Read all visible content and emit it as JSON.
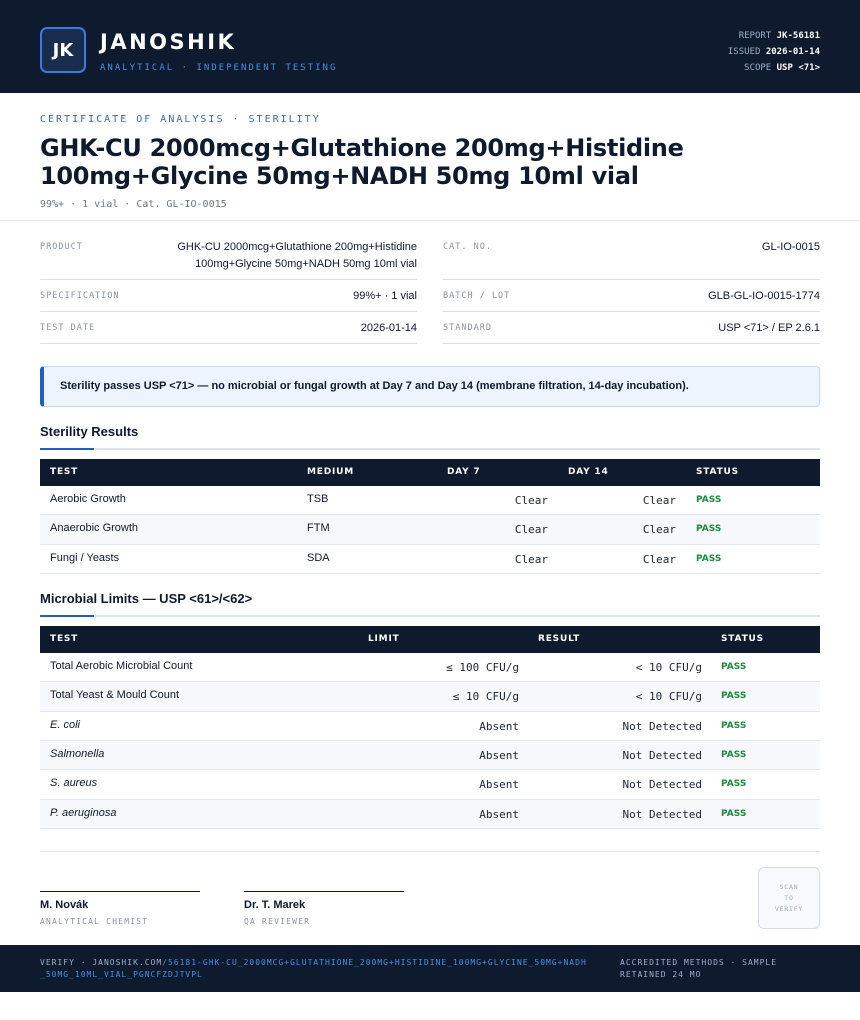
{
  "header": {
    "logo_text": "JK",
    "brand": "JANOSHIK",
    "brand_sub": "ANALYTICAL · INDEPENDENT TESTING",
    "report_label": "REPORT",
    "report_value": "JK-56181",
    "issued_label": "ISSUED",
    "issued_value": "2026-01-14",
    "scope_label": "SCOPE",
    "scope_value": "USP <71>"
  },
  "certificate": {
    "kicker": "CERTIFICATE OF ANALYSIS · STERILITY",
    "title": "GHK-CU 2000mcg+Glutathione 200mg+Histidine 100mg+Glycine 50mg+NADH 50mg 10ml vial",
    "subline": "99%+ · 1 vial · Cat. GL-IO-0015"
  },
  "info": {
    "product_label": "PRODUCT",
    "product_value": "GHK-CU 2000mcg+Glutathione 200mg+Histidine 100mg+Glycine 50mg+NADH 50mg 10ml vial",
    "cat_label": "CAT. NO.",
    "cat_value": "GL-IO-0015",
    "spec_label": "SPECIFICATION",
    "spec_value": "99%+ · 1 vial",
    "batch_label": "BATCH / LOT",
    "batch_value": "GLB-GL-IO-0015-1774",
    "date_label": "TEST DATE",
    "date_value": "2026-01-14",
    "standard_label": "STANDARD",
    "standard_value": "USP <71> / EP 2.6.1"
  },
  "summary": "Sterility passes USP <71> — no microbial or fungal growth at Day 7 and Day 14 (membrane filtration, 14-day incubation).",
  "sterility": {
    "title": "Sterility Results",
    "headers": {
      "test": "TEST",
      "medium": "MEDIUM",
      "day7": "DAY 7",
      "day14": "DAY 14",
      "status": "STATUS"
    },
    "rows": [
      {
        "test": "Aerobic Growth",
        "medium": "TSB",
        "day7": "Clear",
        "day14": "Clear",
        "status": "PASS"
      },
      {
        "test": "Anaerobic Growth",
        "medium": "FTM",
        "day7": "Clear",
        "day14": "Clear",
        "status": "PASS"
      },
      {
        "test": "Fungi / Yeasts",
        "medium": "SDA",
        "day7": "Clear",
        "day14": "Clear",
        "status": "PASS"
      }
    ]
  },
  "microbial": {
    "title": "Microbial Limits — USP <61>/<62>",
    "headers": {
      "test": "TEST",
      "limit": "LIMIT",
      "result": "RESULT",
      "status": "STATUS"
    },
    "rows": [
      {
        "test": "Total Aerobic Microbial Count",
        "limit": "≤ 100 CFU/g",
        "result": "< 10 CFU/g",
        "status": "PASS"
      },
      {
        "test": "Total Yeast & Mould Count",
        "limit": "≤ 10 CFU/g",
        "result": "< 10 CFU/g",
        "status": "PASS"
      },
      {
        "test": "E. coli",
        "limit": "Absent",
        "result": "Not Detected",
        "status": "PASS"
      },
      {
        "test": "Salmonella",
        "limit": "Absent",
        "result": "Not Detected",
        "status": "PASS"
      },
      {
        "test": "S. aureus",
        "limit": "Absent",
        "result": "Not Detected",
        "status": "PASS"
      },
      {
        "test": "P. aeruginosa",
        "limit": "Absent",
        "result": "Not Detected",
        "status": "PASS"
      }
    ]
  },
  "signatures": [
    {
      "name": "M. Novák",
      "role": "ANALYTICAL CHEMIST"
    },
    {
      "name": "Dr. T. Marek",
      "role": "QA REVIEWER"
    }
  ],
  "qr": {
    "line1": "SCAN",
    "line2": "TO",
    "line3": "VERIFY"
  },
  "footer": {
    "verify_prefix": "VERIFY · JANOSHIK.COM",
    "verify_url": "/56181-GHK-CU_2000MCG+GLUTATHIONE_200MG+HISTIDINE_100MG+GLYCINE_50MG+NADH_50MG_10ML_VIAL_PGNCFZDJTVPL",
    "accredited": "ACCREDITED METHODS · SAMPLE RETAINED 24 MO"
  },
  "colors": {
    "navy": "#0e1a2e",
    "accent_blue": "#1f5fbf",
    "pass_green": "#1e8a3c"
  }
}
